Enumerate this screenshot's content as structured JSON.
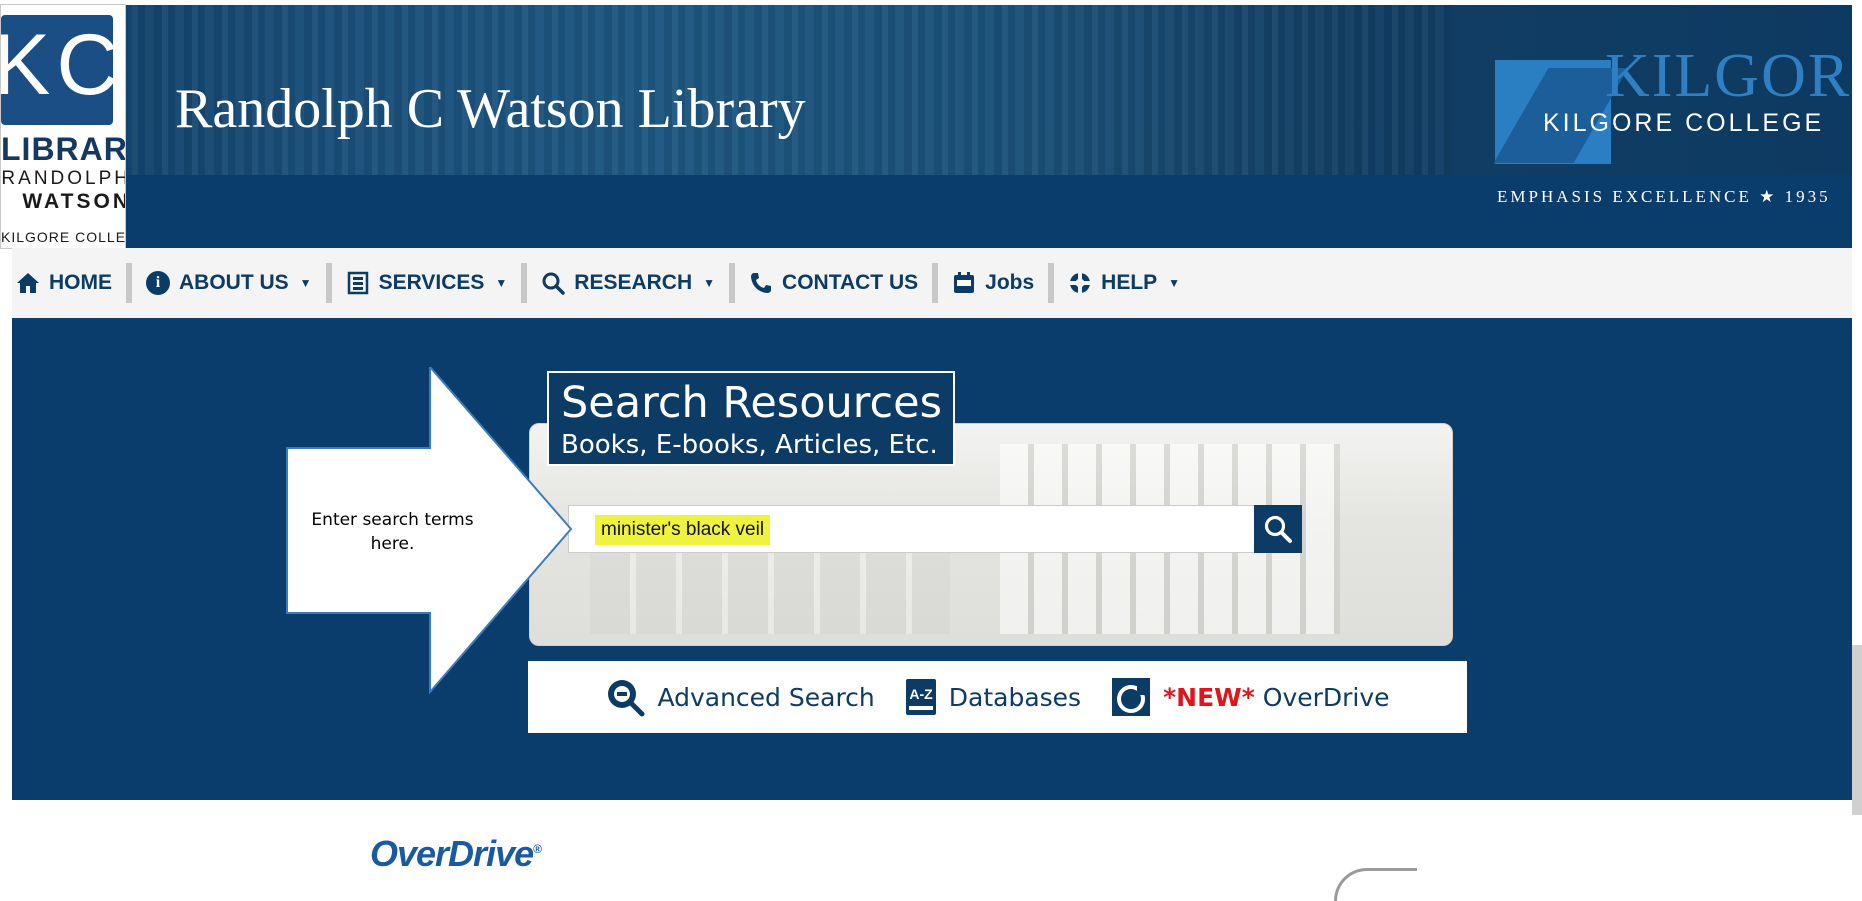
{
  "header": {
    "site_title": "Randolph C Watson Library",
    "logo": {
      "letters": "KC",
      "line1": "LIBRARY",
      "line2": "RANDOLPH",
      "line3": "WATSON",
      "line4": "KILGORE COLLEGE"
    },
    "college": {
      "ghost_text": "KILGORE COLLEGE",
      "name": "KILGORE COLLEGE",
      "tagline": "EMPHASIS EXCELLENCE ★ 1935"
    }
  },
  "nav": {
    "items": [
      {
        "label": "HOME",
        "icon": "home-icon",
        "dropdown": false
      },
      {
        "label": "ABOUT US",
        "icon": "info-icon",
        "dropdown": true
      },
      {
        "label": "SERVICES",
        "icon": "services-icon",
        "dropdown": true
      },
      {
        "label": "RESEARCH",
        "icon": "search-icon",
        "dropdown": true
      },
      {
        "label": "CONTACT US",
        "icon": "phone-icon",
        "dropdown": false
      },
      {
        "label": "Jobs",
        "icon": "jobs-icon",
        "dropdown": false
      },
      {
        "label": "HELP",
        "icon": "lifebuoy-icon",
        "dropdown": true
      }
    ]
  },
  "search": {
    "title": "Search Resources",
    "subtitle": "Books, E-books, Articles, Etc.",
    "query": "minister's black veil",
    "highlight_color": "#f0f240"
  },
  "quick_links": {
    "advanced_search": "Advanced Search",
    "databases": "Databases",
    "new_tag": "*NEW*",
    "overdrive": "OverDrive"
  },
  "callout": {
    "text": "Enter search terms here."
  },
  "below": {
    "overdrive_logo": "OverDrive"
  },
  "colors": {
    "brand_navy": "#0c3b66",
    "header_blue": "#0a3d6b",
    "new_red": "#e0141b"
  }
}
